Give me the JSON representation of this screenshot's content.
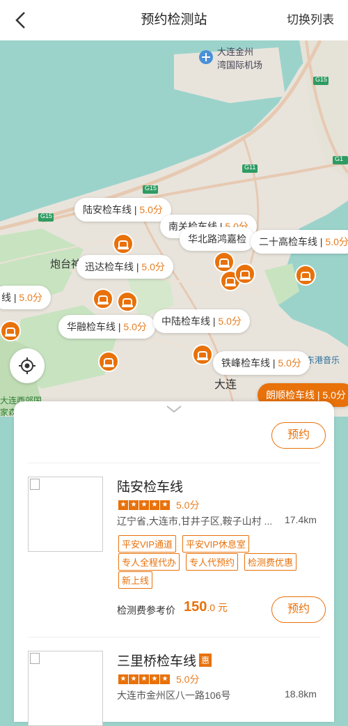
{
  "header": {
    "title": "预约检测站",
    "switch_label": "切换列表"
  },
  "map": {
    "labels": {
      "airport": "大连金州\n湾国际机场",
      "dalian": "大连",
      "west_park": "大连西郊国\n家森",
      "paotai": "炮台神",
      "g15a": "G15",
      "g15b": "G15",
      "g15c": "G15",
      "g11": "G11",
      "g1": "G1",
      "port": "东港音乐"
    },
    "pins": [
      {
        "name": "陆安检车线",
        "score": "5.0分"
      },
      {
        "name": "南关检车线",
        "score": "5.0分"
      },
      {
        "name": "华北路鸿嘉检",
        "score": ""
      },
      {
        "name": "二十高检车线",
        "score": "5.0分"
      },
      {
        "name": "迅达检车线",
        "score": "5.0分"
      },
      {
        "name": "线",
        "score": "5.0分"
      },
      {
        "name": "华融检车线",
        "score": "5.0分"
      },
      {
        "name": "中陆检车线",
        "score": "5.0分"
      },
      {
        "name": "铁峰检车线",
        "score": "5.0分"
      },
      {
        "name": "朗顺检车线",
        "score": "5.0分"
      }
    ]
  },
  "sheet": {
    "top_book_label": "预约",
    "stations": [
      {
        "name": "陆安检车线",
        "score": "5.0分",
        "address": "辽宁省,大连市,甘井子区,鞍子山村 ...",
        "distance": "17.4km",
        "tags": [
          "平安VIP通道",
          "平安VIP休息室",
          "专人全程代办",
          "专人代预约",
          "检测费优惠",
          "新上线"
        ],
        "price_label": "检测费参考价",
        "price_big": "150",
        "price_small": ".0 元",
        "book_label": "预约"
      },
      {
        "name": "三里桥检车线",
        "badge": "惠",
        "score": "5.0分",
        "address": "大连市金州区八一路106号",
        "distance": "18.8km"
      }
    ]
  },
  "colors": {
    "accent": "#e8710a",
    "sea": "#9bd3cb",
    "land": "#e8e4dc"
  }
}
